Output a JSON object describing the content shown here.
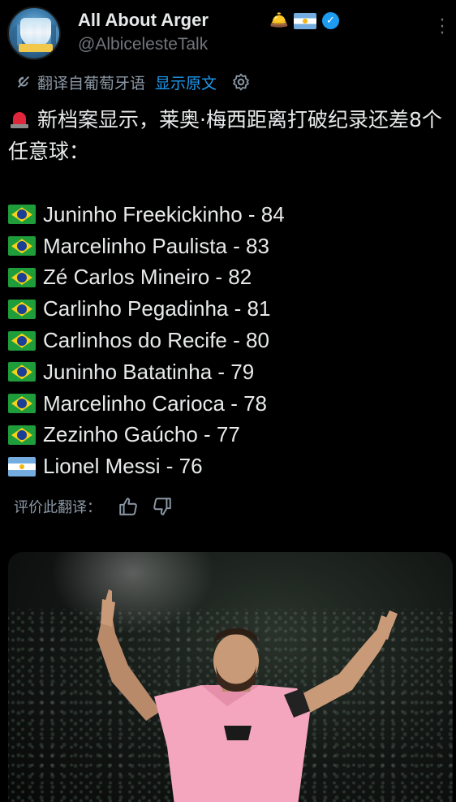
{
  "author": {
    "display_name": "All About Arger",
    "handle": "@AlbicelesteTalk",
    "name_emojis": [
      "bell-emoji",
      "argentina-flag-emoji"
    ],
    "verified": true
  },
  "translation": {
    "label": "翻译自葡萄牙语",
    "show_original": "显示原文"
  },
  "tweet": {
    "headline": "新档案显示，莱奥·梅西距离打破纪录还差8个任意球：",
    "list": [
      {
        "flag": "brazil",
        "text": "Juninho Freekickinho - 84"
      },
      {
        "flag": "brazil",
        "text": "Marcelinho Paulista - 83"
      },
      {
        "flag": "brazil",
        "text": "Zé Carlos Mineiro - 82"
      },
      {
        "flag": "brazil",
        "text": "Carlinho Pegadinha - 81"
      },
      {
        "flag": "brazil",
        "text": "Carlinhos do Recife - 80"
      },
      {
        "flag": "brazil",
        "text": "Juninho Batatinha - 79"
      },
      {
        "flag": "brazil",
        "text": "Marcelinho Carioca - 78"
      },
      {
        "flag": "brazil",
        "text": "Zezinho Gaúcho - 77"
      },
      {
        "flag": "argentina",
        "text": "Lionel Messi - 76"
      }
    ]
  },
  "rating": {
    "label": "评价此翻译："
  },
  "colors": {
    "background": "#000000",
    "text": "#e7e9ea",
    "muted": "#71767b",
    "link": "#1d9bf0",
    "jersey_pink": "#f4a6bf"
  },
  "icons": [
    "translate-icon",
    "settings-icon",
    "thumbs-up-icon",
    "thumbs-down-icon",
    "more-icon",
    "verified-icon",
    "siren-emoji"
  ]
}
